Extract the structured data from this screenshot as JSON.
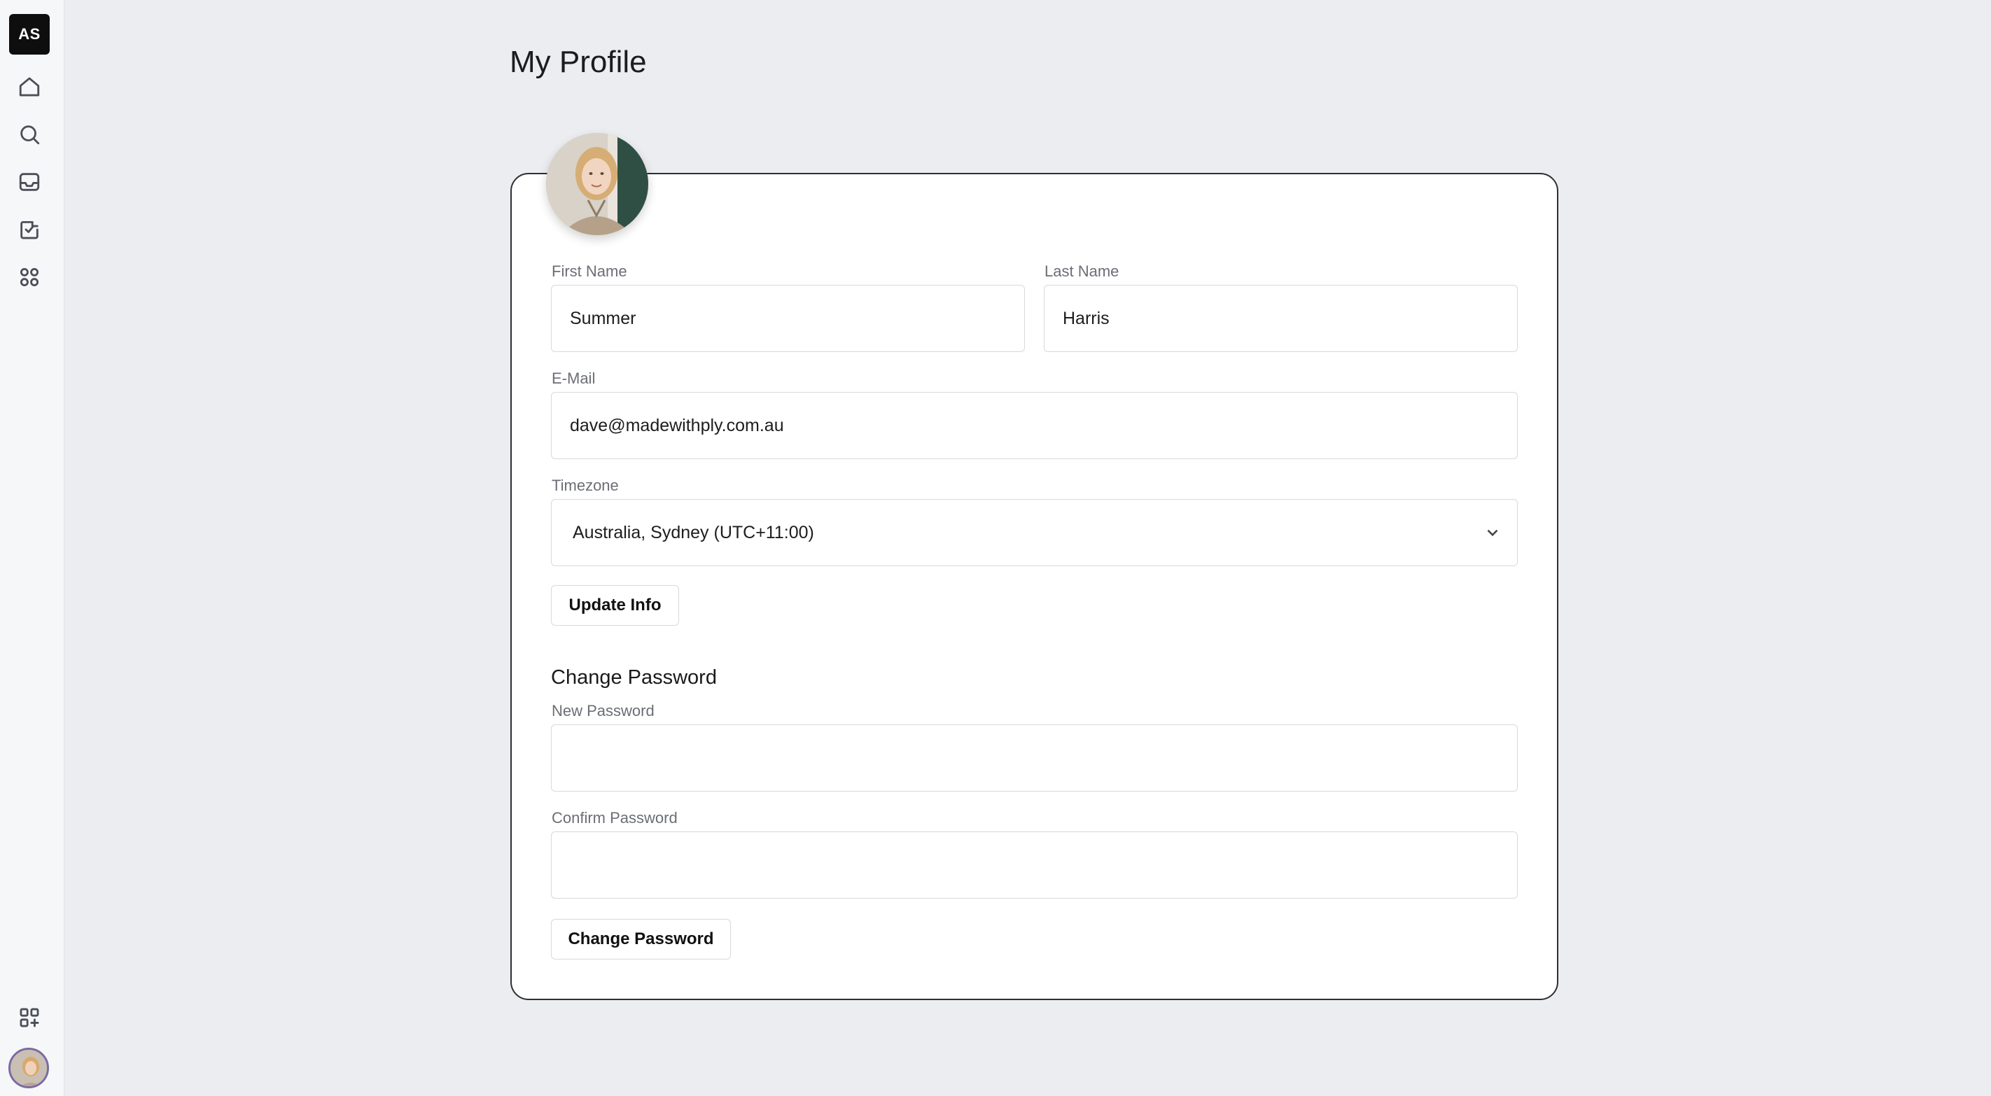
{
  "sidebar": {
    "logo": "AS",
    "items": [
      {
        "name": "home-icon"
      },
      {
        "name": "search-icon"
      },
      {
        "name": "inbox-icon"
      },
      {
        "name": "tasks-icon"
      },
      {
        "name": "apps-icon"
      }
    ],
    "bottom": [
      {
        "name": "add-app-icon"
      },
      {
        "name": "user-avatar"
      }
    ]
  },
  "page": {
    "title": "My Profile"
  },
  "profile": {
    "first_name_label": "First Name",
    "first_name": "Summer",
    "last_name_label": "Last Name",
    "last_name": "Harris",
    "email_label": "E-Mail",
    "email": "dave@madewithply.com.au",
    "timezone_label": "Timezone",
    "timezone": "Australia, Sydney (UTC+11:00)",
    "update_button": "Update Info"
  },
  "password": {
    "title": "Change Password",
    "new_label": "New Password",
    "new_value": "",
    "confirm_label": "Confirm Password",
    "confirm_value": "",
    "button": "Change Password"
  },
  "colors": {
    "background": "#ecedf1",
    "card_border": "#2e2f33",
    "logo_bg": "#0e0e0e"
  }
}
